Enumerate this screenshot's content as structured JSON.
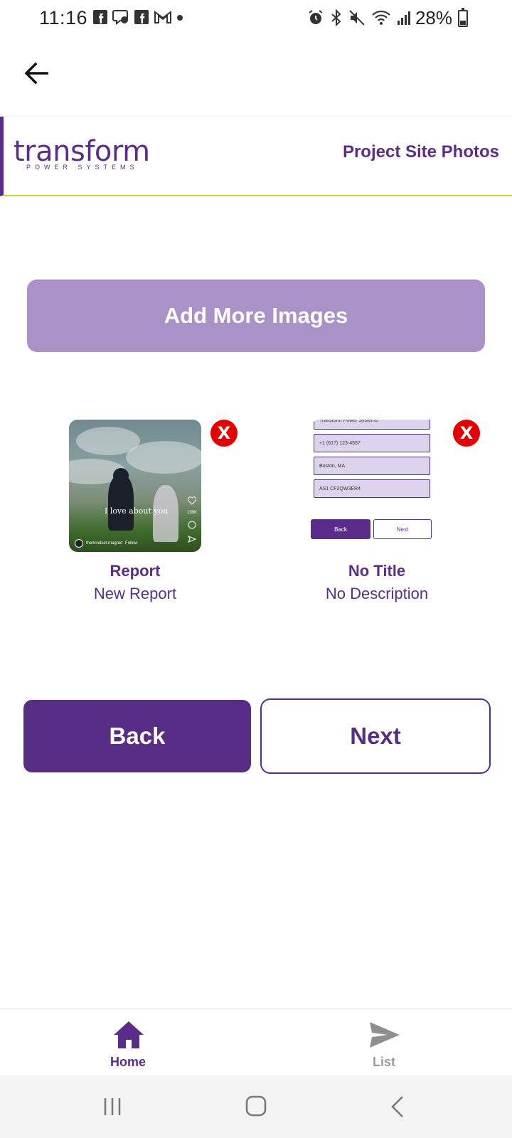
{
  "status_bar": {
    "time": "11:16",
    "left_icons": [
      "facebook-icon",
      "messenger-icon",
      "facebook-icon",
      "gmail-icon",
      "dot-icon"
    ],
    "right_icons": [
      "alarm-icon",
      "bluetooth-icon",
      "mute-icon",
      "wifi-icon",
      "signal-icon"
    ],
    "battery": "28%"
  },
  "header": {
    "logo_main": "transform",
    "logo_sub": "POWER SYSTEMS",
    "title": "Project Site Photos"
  },
  "actions": {
    "add_more_label": "Add More Images",
    "back_label": "Back",
    "next_label": "Next"
  },
  "images": [
    {
      "title": "Report",
      "description": "New Report",
      "remove_label": "X",
      "overlay_text": "I love about you",
      "account": "themindset.magnet",
      "follow": "Follow",
      "likes": "139K"
    },
    {
      "title": "No Title",
      "description": "No Description",
      "remove_label": "X",
      "fields": [
        "Transform Power Systems",
        "+1 (617) 123-4557",
        "Boston, MA",
        "AS1 CF2QW3ER4"
      ],
      "back": "Back",
      "next": "Next"
    }
  ],
  "bottom_nav": {
    "home_label": "Home",
    "list_label": "List"
  },
  "colors": {
    "brand_purple": "#582d85",
    "light_purple": "#a892c8",
    "accent_lime": "#c6d63a",
    "remove_red": "#e60000"
  }
}
